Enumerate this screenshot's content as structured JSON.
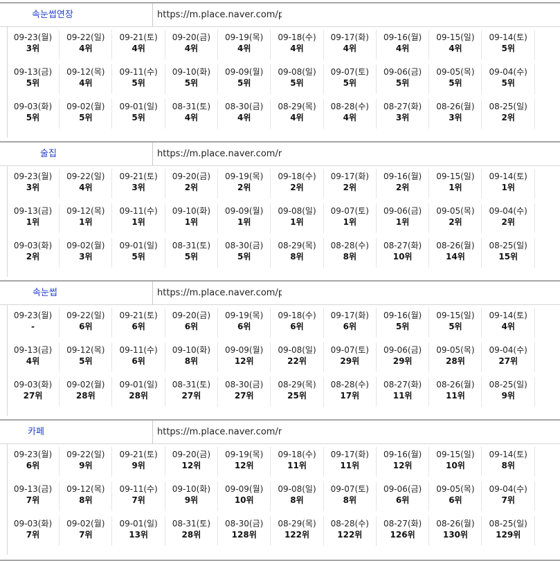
{
  "blocks": [
    {
      "keyword": "속눈썹연장",
      "url": "https://m.place.naver.com/plac",
      "rows": [
        [
          [
            "09-23(월)",
            "3위"
          ],
          [
            "09-22(일)",
            "4위"
          ],
          [
            "09-21(토)",
            "4위"
          ],
          [
            "09-20(금)",
            "4위"
          ],
          [
            "09-19(목)",
            "4위"
          ],
          [
            "09-18(수)",
            "4위"
          ],
          [
            "09-17(화)",
            "4위"
          ],
          [
            "09-16(월)",
            "4위"
          ],
          [
            "09-15(일)",
            "4위"
          ],
          [
            "09-14(토)",
            "5위"
          ]
        ],
        [
          [
            "09-13(금)",
            "5위"
          ],
          [
            "09-12(목)",
            "4위"
          ],
          [
            "09-11(수)",
            "5위"
          ],
          [
            "09-10(화)",
            "5위"
          ],
          [
            "09-09(월)",
            "5위"
          ],
          [
            "09-08(일)",
            "5위"
          ],
          [
            "09-07(토)",
            "5위"
          ],
          [
            "09-06(금)",
            "5위"
          ],
          [
            "09-05(목)",
            "5위"
          ],
          [
            "09-04(수)",
            "5위"
          ]
        ],
        [
          [
            "09-03(화)",
            "5위"
          ],
          [
            "09-02(월)",
            "5위"
          ],
          [
            "09-01(일)",
            "5위"
          ],
          [
            "08-31(토)",
            "4위"
          ],
          [
            "08-30(금)",
            "4위"
          ],
          [
            "08-29(목)",
            "4위"
          ],
          [
            "08-28(수)",
            "4위"
          ],
          [
            "08-27(화)",
            "3위"
          ],
          [
            "08-26(월)",
            "3위"
          ],
          [
            "08-25(일)",
            "2위"
          ]
        ]
      ]
    },
    {
      "keyword": "술집",
      "url": "https://m.place.naver.com/restauran",
      "rows": [
        [
          [
            "09-23(월)",
            "3위"
          ],
          [
            "09-22(일)",
            "4위"
          ],
          [
            "09-21(토)",
            "3위"
          ],
          [
            "09-20(금)",
            "2위"
          ],
          [
            "09-19(목)",
            "2위"
          ],
          [
            "09-18(수)",
            "2위"
          ],
          [
            "09-17(화)",
            "2위"
          ],
          [
            "09-16(월)",
            "2위"
          ],
          [
            "09-15(일)",
            "1위"
          ],
          [
            "09-14(토)",
            "1위"
          ]
        ],
        [
          [
            "09-13(금)",
            "1위"
          ],
          [
            "09-12(목)",
            "1위"
          ],
          [
            "09-11(수)",
            "1위"
          ],
          [
            "09-10(화)",
            "1위"
          ],
          [
            "09-09(월)",
            "1위"
          ],
          [
            "09-08(일)",
            "1위"
          ],
          [
            "09-07(토)",
            "1위"
          ],
          [
            "09-06(금)",
            "1위"
          ],
          [
            "09-05(목)",
            "2위"
          ],
          [
            "09-04(수)",
            "2위"
          ]
        ],
        [
          [
            "09-03(화)",
            "2위"
          ],
          [
            "09-02(월)",
            "3위"
          ],
          [
            "09-01(일)",
            "5위"
          ],
          [
            "08-31(토)",
            "5위"
          ],
          [
            "08-30(금)",
            "5위"
          ],
          [
            "08-29(목)",
            "8위"
          ],
          [
            "08-28(수)",
            "8위"
          ],
          [
            "08-27(화)",
            "10위"
          ],
          [
            "08-26(월)",
            "14위"
          ],
          [
            "08-25(일)",
            "15위"
          ]
        ]
      ]
    },
    {
      "keyword": "속눈썹",
      "url": "https://m.place.naver.com/plac",
      "rows": [
        [
          [
            "09-23(월)",
            "-"
          ],
          [
            "09-22(일)",
            "6위"
          ],
          [
            "09-21(토)",
            "6위"
          ],
          [
            "09-20(금)",
            "6위"
          ],
          [
            "09-19(목)",
            "6위"
          ],
          [
            "09-18(수)",
            "6위"
          ],
          [
            "09-17(화)",
            "6위"
          ],
          [
            "09-16(월)",
            "5위"
          ],
          [
            "09-15(일)",
            "5위"
          ],
          [
            "09-14(토)",
            "4위"
          ]
        ],
        [
          [
            "09-13(금)",
            "4위"
          ],
          [
            "09-12(목)",
            "5위"
          ],
          [
            "09-11(수)",
            "6위"
          ],
          [
            "09-10(화)",
            "8위"
          ],
          [
            "09-09(월)",
            "12위"
          ],
          [
            "09-08(일)",
            "22위"
          ],
          [
            "09-07(토)",
            "29위"
          ],
          [
            "09-06(금)",
            "29위"
          ],
          [
            "09-05(목)",
            "28위"
          ],
          [
            "09-04(수)",
            "27위"
          ]
        ],
        [
          [
            "09-03(화)",
            "27위"
          ],
          [
            "09-02(월)",
            "28위"
          ],
          [
            "09-01(일)",
            "28위"
          ],
          [
            "08-31(토)",
            "27위"
          ],
          [
            "08-30(금)",
            "27위"
          ],
          [
            "08-29(목)",
            "25위"
          ],
          [
            "08-28(수)",
            "17위"
          ],
          [
            "08-27(화)",
            "11위"
          ],
          [
            "08-26(월)",
            "11위"
          ],
          [
            "08-25(일)",
            "9위"
          ]
        ]
      ]
    },
    {
      "keyword": "카페",
      "url": "https://m.place.naver.com/restauran",
      "rows": [
        [
          [
            "09-23(월)",
            "6위"
          ],
          [
            "09-22(일)",
            "9위"
          ],
          [
            "09-21(토)",
            "9위"
          ],
          [
            "09-20(금)",
            "12위"
          ],
          [
            "09-19(목)",
            "12위"
          ],
          [
            "09-18(수)",
            "11위"
          ],
          [
            "09-17(화)",
            "11위"
          ],
          [
            "09-16(월)",
            "12위"
          ],
          [
            "09-15(일)",
            "10위"
          ],
          [
            "09-14(토)",
            "8위"
          ]
        ],
        [
          [
            "09-13(금)",
            "7위"
          ],
          [
            "09-12(목)",
            "8위"
          ],
          [
            "09-11(수)",
            "7위"
          ],
          [
            "09-10(화)",
            "9위"
          ],
          [
            "09-09(월)",
            "10위"
          ],
          [
            "09-08(일)",
            "8위"
          ],
          [
            "09-07(토)",
            "8위"
          ],
          [
            "09-06(금)",
            "6위"
          ],
          [
            "09-05(목)",
            "6위"
          ],
          [
            "09-04(수)",
            "7위"
          ]
        ],
        [
          [
            "09-03(화)",
            "7위"
          ],
          [
            "09-02(월)",
            "7위"
          ],
          [
            "09-01(일)",
            "13위"
          ],
          [
            "08-31(토)",
            "28위"
          ],
          [
            "08-30(금)",
            "128위"
          ],
          [
            "08-29(목)",
            "122위"
          ],
          [
            "08-28(수)",
            "122위"
          ],
          [
            "08-27(화)",
            "126위"
          ],
          [
            "08-26(월)",
            "130위"
          ],
          [
            "08-25(일)",
            "129위"
          ]
        ]
      ]
    }
  ],
  "colors": {
    "keyword": "#1f3fcf",
    "border": "#a6a6a6"
  }
}
